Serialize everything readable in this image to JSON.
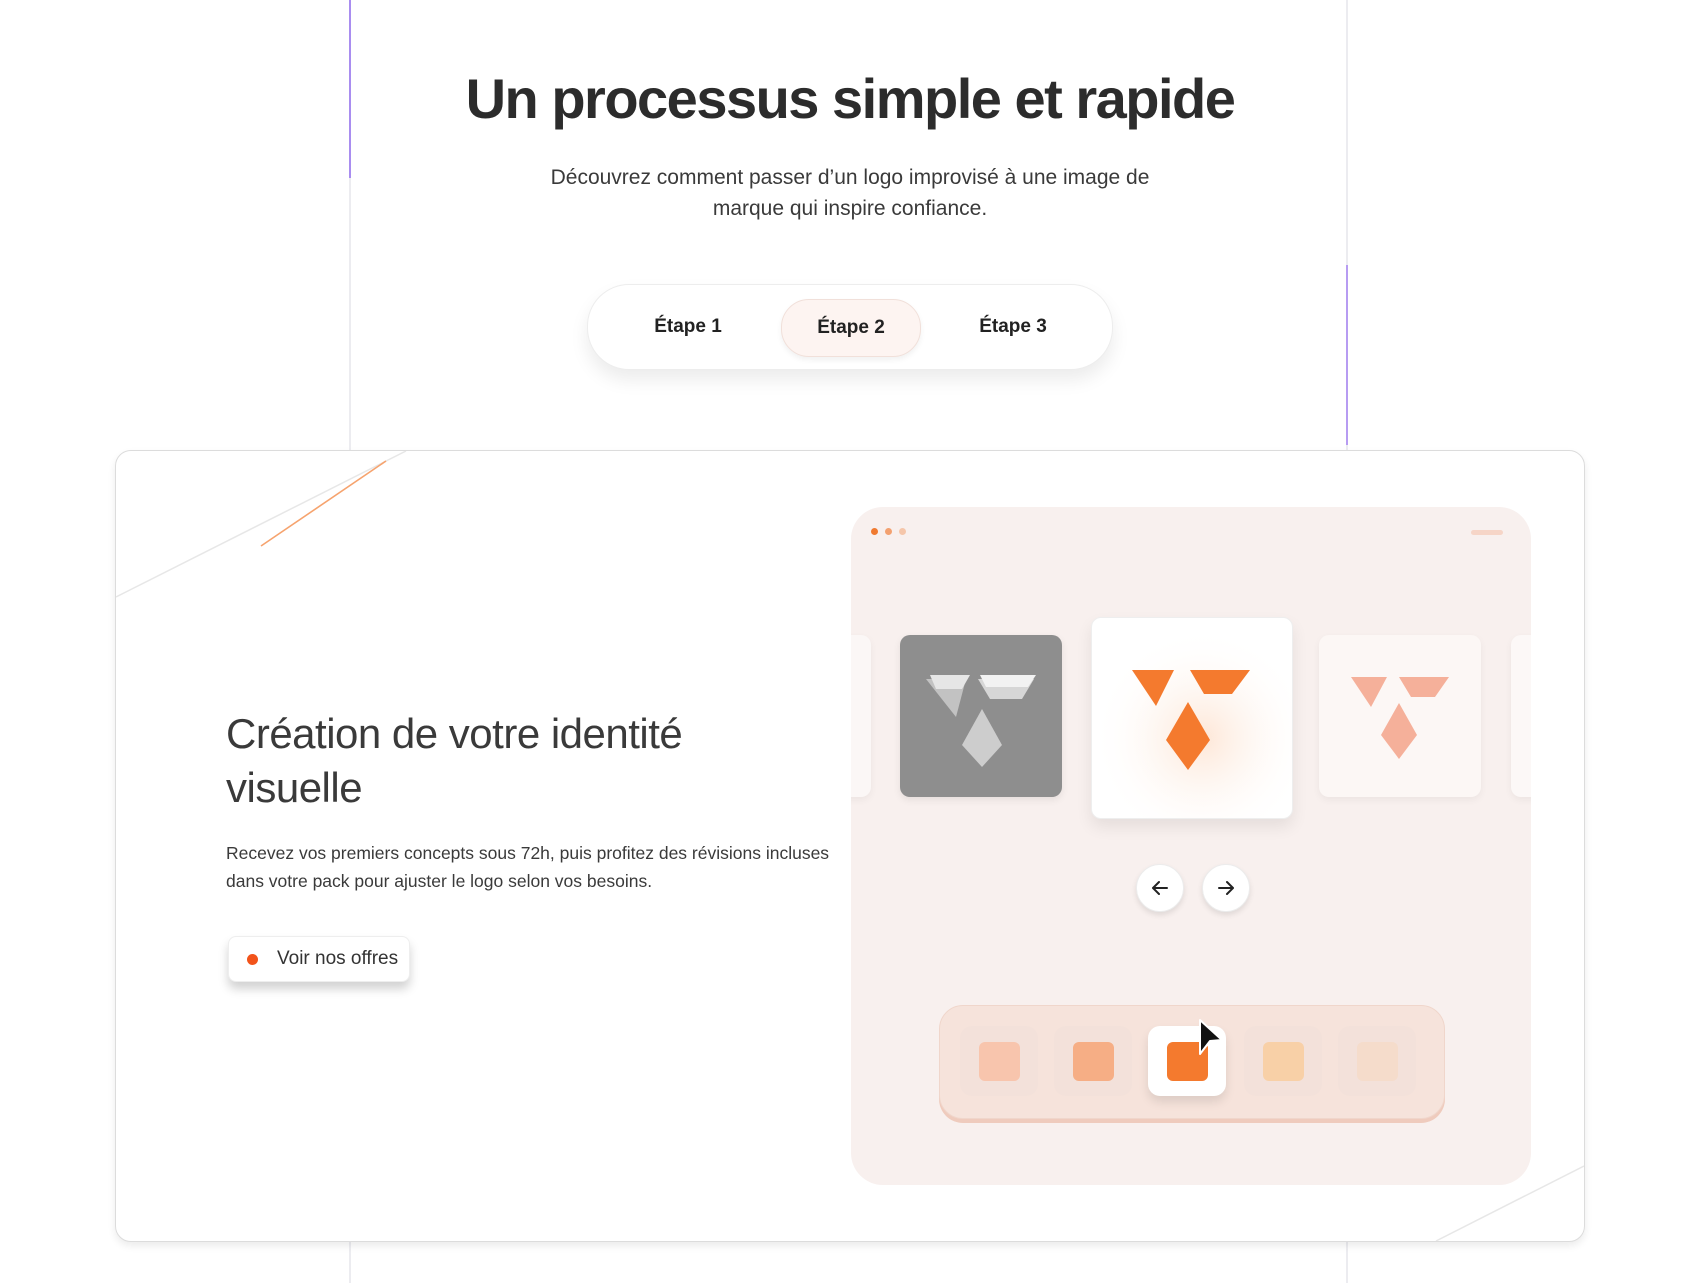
{
  "section": {
    "title": "Un processus simple et rapide",
    "subtitle": "Découvrez comment passer d’un logo improvisé à une image de marque qui inspire confiance."
  },
  "steps": {
    "items": [
      {
        "label": "Étape 1"
      },
      {
        "label": "Étape 2"
      },
      {
        "label": "Étape 3"
      }
    ],
    "active_index": 1
  },
  "card": {
    "title": "Création de votre identité visuelle",
    "text": "Recevez vos premiers concepts sous 72h, puis profitez des révisions incluses dans votre pack pour ajuster le logo selon vos besoins.",
    "cta_label": "Voir nos offres"
  },
  "mockup": {
    "icons": {
      "prev": "arrow-left-icon",
      "next": "arrow-right-icon",
      "pointer": "mouse-pointer-icon",
      "logo": "v-logo-icon"
    },
    "palette": [
      "#f8c5ad",
      "#f6ae85",
      "#f47a2e",
      "#f8d0a7",
      "#f5dccb"
    ],
    "active_swatch_index": 2
  },
  "colors": {
    "accent": "#f47a2e",
    "cta_dot": "#f2531a",
    "guide_accent": "#a98df0"
  }
}
